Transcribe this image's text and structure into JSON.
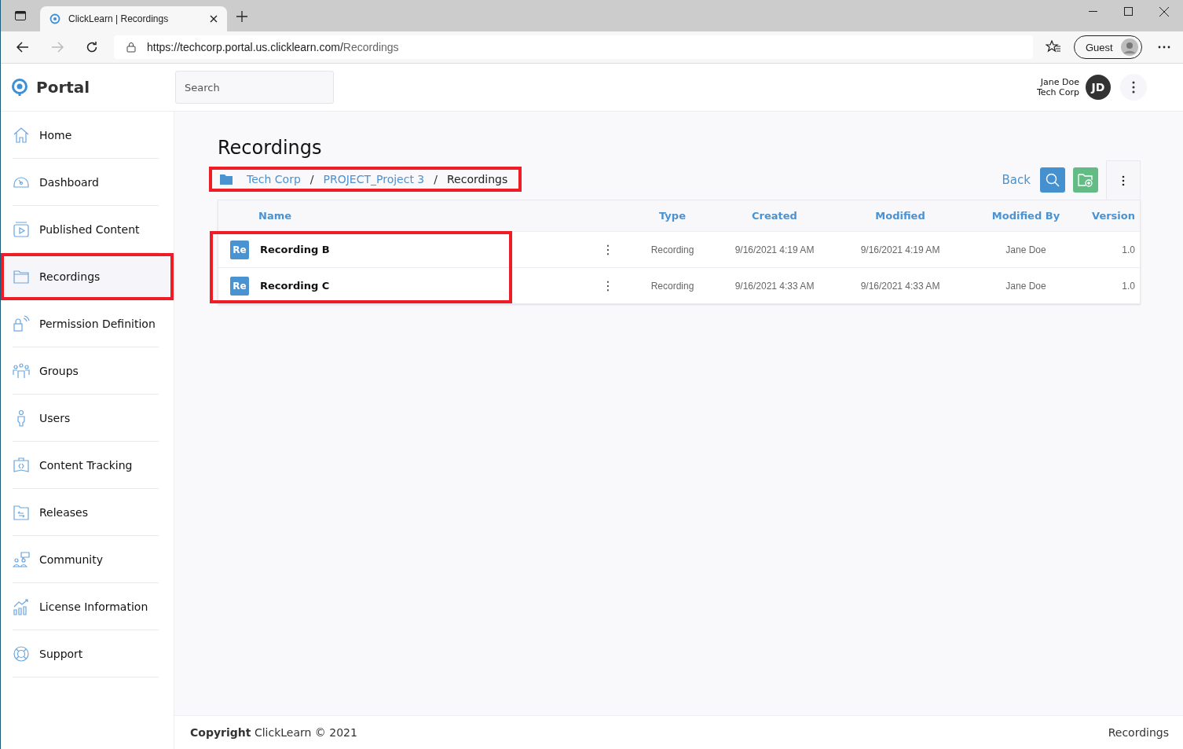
{
  "browser": {
    "tab_title": "ClickLearn | Recordings",
    "url_host": "https://techcorp.portal.us.clicklearn.com/",
    "url_path": "Recordings",
    "profile": "Guest"
  },
  "header": {
    "logo": "Portal",
    "search": {
      "placeholder": "Search"
    },
    "user_name": "Jane Doe",
    "user_org": "Tech Corp",
    "avatar": "JD"
  },
  "sidebar": {
    "items": [
      {
        "label": "Home",
        "kind": "home",
        "selected": false,
        "highlighted": false
      },
      {
        "label": "Dashboard",
        "kind": "gauge",
        "selected": false,
        "highlighted": false
      },
      {
        "label": "Published Content",
        "kind": "play",
        "selected": false,
        "highlighted": false
      },
      {
        "label": "Recordings",
        "kind": "folder",
        "selected": true,
        "highlighted": true
      },
      {
        "label": "Permission Definition",
        "kind": "lock",
        "selected": false,
        "highlighted": false
      },
      {
        "label": "Groups",
        "kind": "group",
        "selected": false,
        "highlighted": false
      },
      {
        "label": "Users",
        "kind": "user",
        "selected": false,
        "highlighted": false
      },
      {
        "label": "Content Tracking",
        "kind": "code",
        "selected": false,
        "highlighted": false
      },
      {
        "label": "Releases",
        "kind": "release",
        "selected": false,
        "highlighted": false
      },
      {
        "label": "Community",
        "kind": "community",
        "selected": false,
        "highlighted": false
      },
      {
        "label": "License Information",
        "kind": "chart",
        "selected": false,
        "highlighted": false
      },
      {
        "label": "Support",
        "kind": "lifebuoy",
        "selected": false,
        "highlighted": false
      }
    ]
  },
  "page": {
    "title": "Recordings",
    "breadcrumb": {
      "highlighted": true,
      "items": [
        "Tech Corp",
        "PROJECT_Project 3",
        "Recordings"
      ],
      "separator": "/"
    },
    "back": "Back"
  },
  "table": {
    "columns": [
      "Name",
      "Type",
      "Created",
      "Modified",
      "Modified By",
      "Version"
    ],
    "names_highlighted": true,
    "rows": [
      {
        "badge": "Re",
        "name": "Recording B",
        "menu": "⋮",
        "type": "Recording",
        "created": "9/16/2021 4:19 AM",
        "modified": "9/16/2021 4:19 AM",
        "modified_by": "Jane Doe",
        "version": "1.0"
      },
      {
        "badge": "Re",
        "name": "Recording C",
        "menu": "⋮",
        "type": "Recording",
        "created": "9/16/2021 4:33 AM",
        "modified": "9/16/2021 4:33 AM",
        "modified_by": "Jane Doe",
        "version": "1.0"
      }
    ]
  },
  "footer": {
    "copyright_bold": "Copyright",
    "copyright": "ClickLearn © 2021",
    "page": "Recordings"
  }
}
